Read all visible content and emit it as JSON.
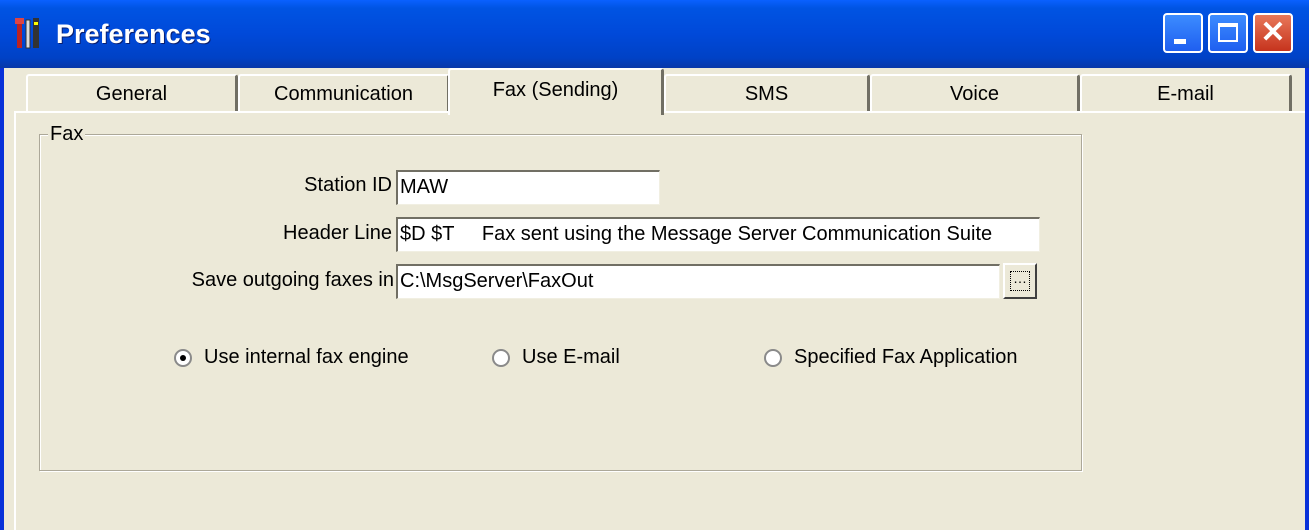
{
  "window": {
    "title": "Preferences"
  },
  "tabs": [
    {
      "label": "General",
      "active": false
    },
    {
      "label": "Communication",
      "active": false
    },
    {
      "label": "Fax (Sending)",
      "active": true
    },
    {
      "label": "SMS",
      "active": false
    },
    {
      "label": "Voice",
      "active": false
    },
    {
      "label": "E-mail",
      "active": false
    }
  ],
  "fax": {
    "group_label": "Fax",
    "station_id": {
      "label": "Station ID",
      "value": "MAW"
    },
    "header_line": {
      "label": "Header Line",
      "value": "$D $T     Fax sent using the Message Server Communication Suite"
    },
    "save_outgoing": {
      "label": "Save outgoing faxes in",
      "value": "C:\\MsgServer\\FaxOut"
    },
    "browse_icon": "ellipsis-icon",
    "options": [
      {
        "label": "Use internal fax engine",
        "checked": true
      },
      {
        "label": "Use E-mail",
        "checked": false
      },
      {
        "label": "Specified Fax Application",
        "checked": false
      }
    ]
  },
  "colors": {
    "titlebar": "#0054e3",
    "face": "#ece9d8",
    "close": "#c6331d"
  }
}
